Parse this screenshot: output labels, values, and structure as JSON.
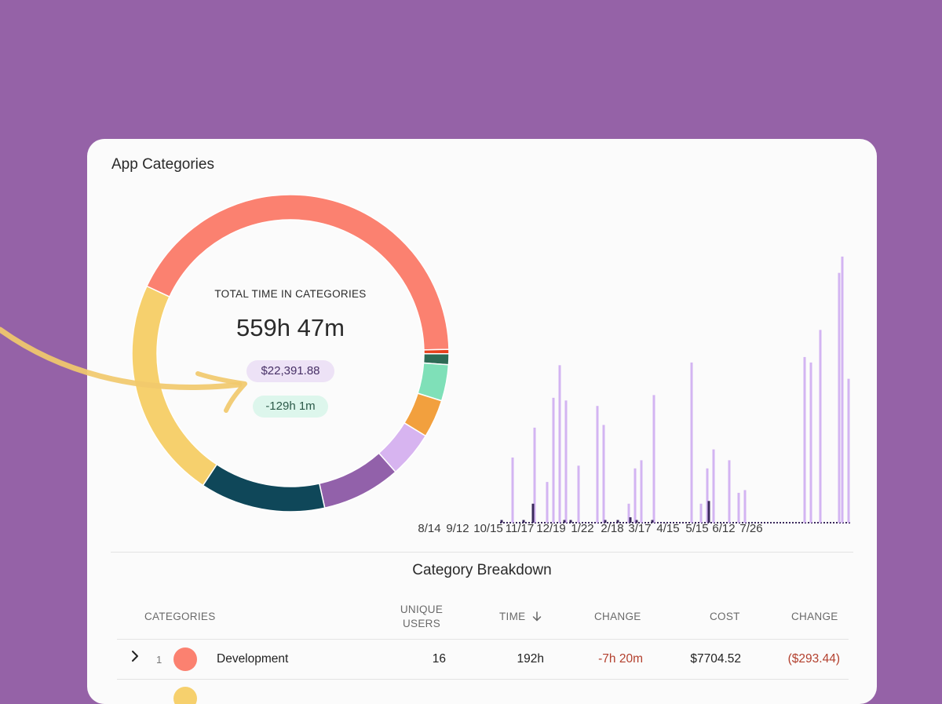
{
  "window": {
    "background_color": "#9562a7"
  },
  "card": {
    "title": "App Categories"
  },
  "summary": {
    "label": "TOTAL TIME IN CATEGORIES",
    "total": "559h 47m",
    "cost": "$22,391.88",
    "change": "-129h 1m"
  },
  "donut_segments": [
    {
      "color": "#fb8170",
      "start_deg": 295,
      "end_deg": 88.6
    },
    {
      "color": "#e8401c",
      "start_deg": 88.6,
      "end_deg": 90.2
    },
    {
      "color": "#2e6b55",
      "start_deg": 90.2,
      "end_deg": 94.2
    },
    {
      "color": "#7fe0b8",
      "start_deg": 94.2,
      "end_deg": 107.5
    },
    {
      "color": "#f2a03e",
      "start_deg": 107.5,
      "end_deg": 121.5
    },
    {
      "color": "#d7b4f0",
      "start_deg": 121.5,
      "end_deg": 138.5
    },
    {
      "color": "#9261aa",
      "start_deg": 138.5,
      "end_deg": 167.5
    },
    {
      "color": "#0f4759",
      "start_deg": 167.5,
      "end_deg": 213.5
    },
    {
      "color": "#f6d06d",
      "start_deg": 213.5,
      "end_deg": 295
    }
  ],
  "chart_data": {
    "type": "bar",
    "x_tick_labels": [
      "8/14",
      "9/12",
      "10/15",
      "11/17",
      "12/19",
      "1/22",
      "2/18",
      "3/17",
      "4/15",
      "5/15",
      "6/12",
      "7/26"
    ],
    "series": [
      {
        "color": "#d3b4f2",
        "values": [
          0.0,
          0.0,
          0.0,
          0.0,
          0.24,
          0.0,
          0.0,
          0.0,
          0.0,
          0.0,
          0.0,
          0.35,
          0.0,
          0.0,
          0.0,
          0.15,
          0.0,
          0.46,
          0.0,
          0.58,
          0.0,
          0.45,
          0.0,
          0.0,
          0.0,
          0.21,
          0.0,
          0.0,
          0.0,
          0.0,
          0.0,
          0.43,
          0.0,
          0.36,
          0.0,
          0.0,
          0.0,
          0.0,
          0.0,
          0.0,
          0.0,
          0.07,
          0.0,
          0.2,
          0.0,
          0.23,
          0.0,
          0.0,
          0.0,
          0.47,
          0.0,
          0.0,
          0.0,
          0.0,
          0.0,
          0.0,
          0.0,
          0.0,
          0.0,
          0.0,
          0.0,
          0.59,
          0.0,
          0.0,
          0.07,
          0.0,
          0.2,
          0.0,
          0.27,
          0.0,
          0.0,
          0.0,
          0.0,
          0.23,
          0.0,
          0.0,
          0.11,
          0.0,
          0.12,
          0.0,
          0.0,
          0.0,
          0.0,
          0.0,
          0.0,
          0.0,
          0.0,
          0.0,
          0.0,
          0.0,
          0.0,
          0.0,
          0.0,
          0.0,
          0.0,
          0.0,
          0.0,
          0.61,
          0.0,
          0.59,
          0.0,
          0.0,
          0.71,
          0.0,
          0.0,
          0.0,
          0.0,
          0.0,
          0.92,
          0.98,
          0.0,
          0.53,
          0.0
        ]
      },
      {
        "color": "#3b2a5c",
        "values": [
          0.0,
          0.01,
          0.0,
          0.0,
          0.0,
          0.0,
          0.0,
          0.0,
          0.01,
          0.0,
          0.0,
          0.07,
          0.0,
          0.0,
          0.0,
          0.0,
          0.0,
          0.0,
          0.0,
          0.0,
          0.0,
          0.01,
          0.0,
          0.01,
          0.0,
          0.0,
          0.0,
          0.0,
          0.0,
          0.0,
          0.0,
          0.0,
          0.0,
          0.0,
          0.01,
          0.0,
          0.0,
          0.0,
          0.01,
          0.0,
          0.0,
          0.0,
          0.02,
          0.0,
          0.01,
          0.0,
          0.0,
          0.0,
          0.0,
          0.01,
          0.0,
          0.0,
          0.0,
          0.0,
          0.0,
          0.0,
          0.0,
          0.0,
          0.0,
          0.0,
          0.0,
          0.0,
          0.0,
          0.0,
          0.0,
          0.0,
          0.0,
          0.08,
          0.0,
          0.0,
          0.0,
          0.0,
          0.0,
          0.0,
          0.0,
          0.0,
          0.0,
          0.0,
          0.0,
          0.0,
          0.0,
          0.0,
          0.0,
          0.0,
          0.0,
          0.0,
          0.0,
          0.0,
          0.0,
          0.0,
          0.0,
          0.0,
          0.0,
          0.0,
          0.0,
          0.0,
          0.0,
          0.0,
          0.0,
          0.0,
          0.0,
          0.0,
          0.0,
          0.0,
          0.0,
          0.0,
          0.0,
          0.0,
          0.0,
          0.0,
          0.0,
          0.0,
          0.0
        ]
      }
    ]
  },
  "breakdown": {
    "title": "Category Breakdown",
    "headers": {
      "categories": "CATEGORIES",
      "unique_users_line1": "UNIQUE",
      "unique_users_line2": "USERS",
      "time": "TIME",
      "time_sort_icon": "arrow-down-icon",
      "change": "CHANGE",
      "cost": "COST",
      "cost_change": "CHANGE"
    },
    "rows": [
      {
        "rank": "1",
        "color": "#fb8170",
        "name": "Development",
        "unique_users": "16",
        "time": "192h",
        "change": "-7h 20m",
        "cost": "$7704.52",
        "cost_change": "($293.44)"
      }
    ],
    "next_row_color": "#f6d06d"
  },
  "colors": {
    "negative": "#b3402e",
    "accent_purple": "#9562a7",
    "arrow": "#f1c96c"
  }
}
